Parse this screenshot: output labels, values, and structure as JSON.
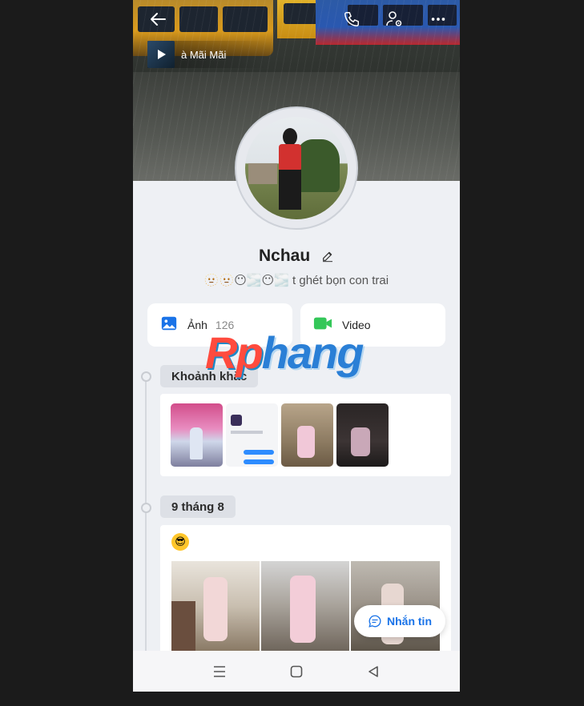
{
  "header": {
    "music_label": "à Mãi Mãi",
    "icons": [
      "back-arrow-icon",
      "phone-icon",
      "user-settings-icon",
      "more-icon"
    ]
  },
  "profile": {
    "name": "Nchau",
    "status": "🫥🫥😶🌫️😶🌫️ t ghét bọn con trai"
  },
  "media": {
    "photos_label": "Ảnh",
    "photos_count": "126",
    "video_label": "Video"
  },
  "watermark": {
    "part1": "Rp",
    "part2": "hang"
  },
  "timeline": {
    "moments_label": "Khoảnh khắc",
    "post_date": "9 tháng 8",
    "post_emoji": "😎"
  },
  "actions": {
    "message_label": "Nhắn tin"
  },
  "colors": {
    "accent": "#1a73e8",
    "video_green": "#34c759",
    "photo_blue": "#1a73e8"
  }
}
